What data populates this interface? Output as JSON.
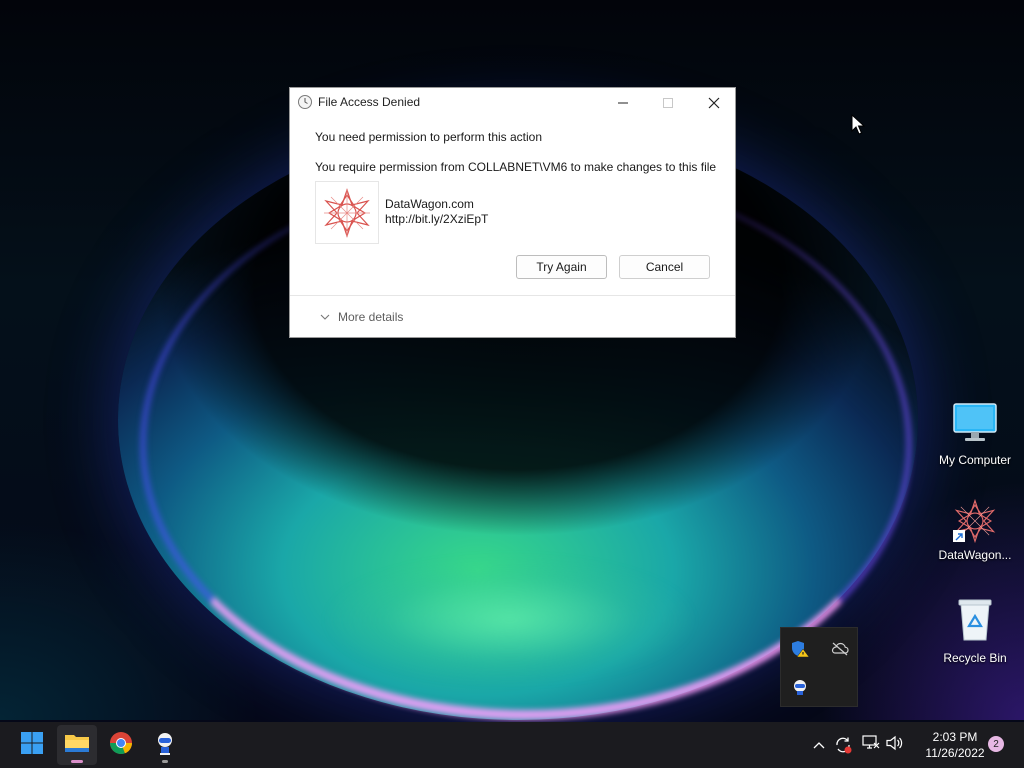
{
  "dialog": {
    "title": "File Access Denied",
    "message": "You need permission to perform this action",
    "detail": "You require permission from COLLABNET\\VM6 to make changes to this file",
    "app_name": "DataWagon.com",
    "app_url": "http://bit.ly/2XziEpT",
    "try_again_label": "Try Again",
    "cancel_label": "Cancel",
    "more_details_label": "More details"
  },
  "desktop": {
    "icons": [
      {
        "label": "My Computer",
        "icon": "monitor-icon"
      },
      {
        "label": "DataWagon...",
        "icon": "datawagon-shortcut-icon"
      },
      {
        "label": "Recycle Bin",
        "icon": "recycle-bin-icon"
      }
    ]
  },
  "taskbar": {
    "apps": [
      "start-icon",
      "file-explorer-icon",
      "chrome-icon",
      "robot-app-icon"
    ],
    "clock": {
      "time": "2:03 PM",
      "date": "11/26/2022"
    },
    "notification_count": "2"
  },
  "tray_flyout": {
    "icons": [
      "windows-security-warning-icon",
      "onedrive-offline-icon",
      "robot-tray-icon"
    ]
  },
  "colors": {
    "taskbar_bg": "#1b1b1f",
    "dialog_bg": "#ffffff",
    "accent_pink": "#d98fc9"
  }
}
